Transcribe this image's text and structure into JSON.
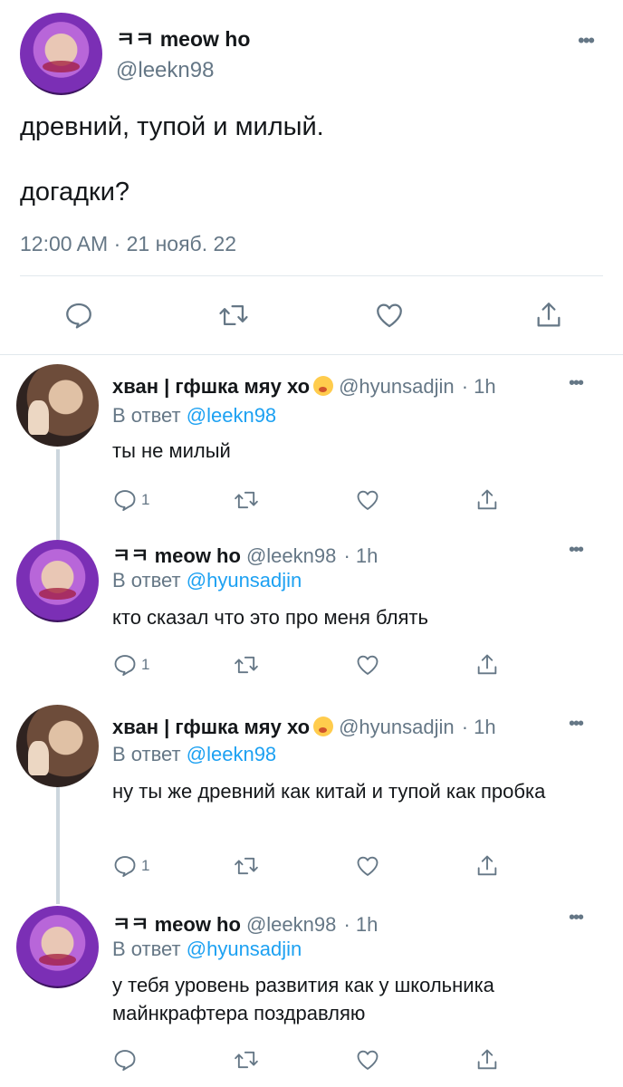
{
  "main_tweet": {
    "display_name": "ㅋㅋ meow ho",
    "handle": "@leekn98",
    "text_line1": "древний, тупой и милый.",
    "text_line2": "догадки?",
    "meta": "12:00 AM · 21 нояб. 22",
    "more_glyph": "•••",
    "avatar_icon": "avatar-purple"
  },
  "replies": [
    {
      "display_name": "хван | гфшка мяу хо",
      "emoji": "yawning-face-emoji",
      "handle": "@hyunsadjin",
      "time": "· 1h",
      "reply_prefix": "В ответ",
      "reply_to": "@leekn98",
      "text": "ты не милый",
      "reply_count": "1",
      "more_glyph": "•••"
    },
    {
      "display_name": "ㅋㅋ meow ho",
      "handle": "@leekn98",
      "time": "· 1h",
      "reply_prefix": "В ответ",
      "reply_to": "@hyunsadjin",
      "text": "кто сказал что это про меня блять",
      "reply_count": "1",
      "more_glyph": "•••"
    },
    {
      "display_name": "хван | гфшка мяу хо",
      "emoji": "yawning-face-emoji",
      "handle": "@hyunsadjin",
      "time": "· 1h",
      "reply_prefix": "В ответ",
      "reply_to": "@leekn98",
      "text": "ну ты же древний как китай и тупой как пробка",
      "reply_count": "1",
      "more_glyph": "•••"
    },
    {
      "display_name": "ㅋㅋ meow ho",
      "handle": "@leekn98",
      "time": "· 1h",
      "reply_prefix": "В ответ",
      "reply_to": "@hyunsadjin",
      "text": "у тебя уровень развития как у школьника майнкрафтера поздравляю",
      "reply_count": "",
      "more_glyph": "•••"
    }
  ],
  "colors": {
    "text": "#14171a",
    "secondary": "#657786",
    "link": "#1da1f2",
    "divider": "#e1e8ed",
    "thread_line": "#ccd6dd"
  },
  "icons": [
    "reply-icon",
    "retweet-icon",
    "like-icon",
    "share-icon",
    "more-icon"
  ]
}
